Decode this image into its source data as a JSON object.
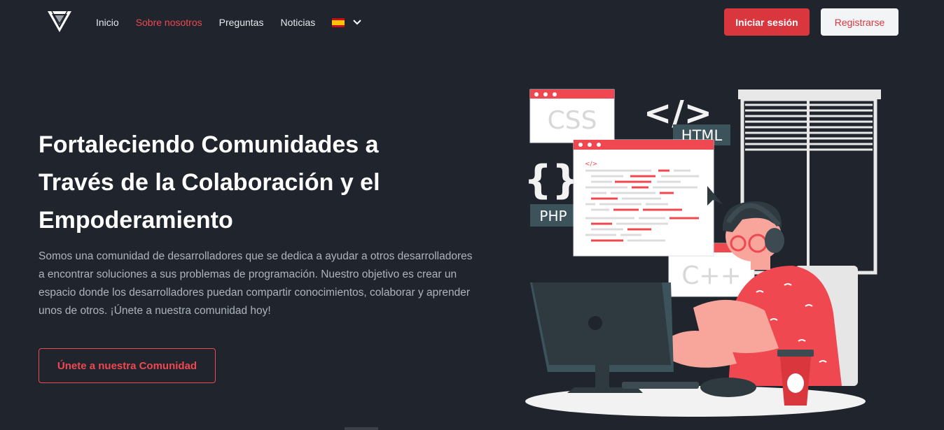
{
  "nav": {
    "links": [
      {
        "label": "Inicio",
        "active": false
      },
      {
        "label": "Sobre nosotros",
        "active": true
      },
      {
        "label": "Preguntas",
        "active": false
      },
      {
        "label": "Noticias",
        "active": false
      }
    ],
    "language_icon": "spain-flag-icon",
    "login_label": "Iniciar sesión",
    "register_label": "Registrarse"
  },
  "hero": {
    "title": "Fortaleciendo Comunidades a Través de la Colaboración y el Empoderamiento",
    "description": "Somos una comunidad de desarrolladores que se dedica a ayudar a otros desarrolladores a encontrar soluciones a sus problemas de programación. Nuestro objetivo es crear un espacio donde los desarrolladores puedan compartir conocimientos, colaborar y aprender unos de otros. ¡Únete a nuestra comunidad hoy!",
    "cta_label": "Únete a nuestra Comunidad"
  },
  "illustration": {
    "labels": {
      "css": "CSS",
      "html": "HTML",
      "php": "PHP",
      "cpp": "C++",
      "code_tag": "</>",
      "braces": "{}"
    }
  },
  "colors": {
    "background": "#1f242d",
    "accent": "#ef4850",
    "button_red": "#d9363e"
  }
}
